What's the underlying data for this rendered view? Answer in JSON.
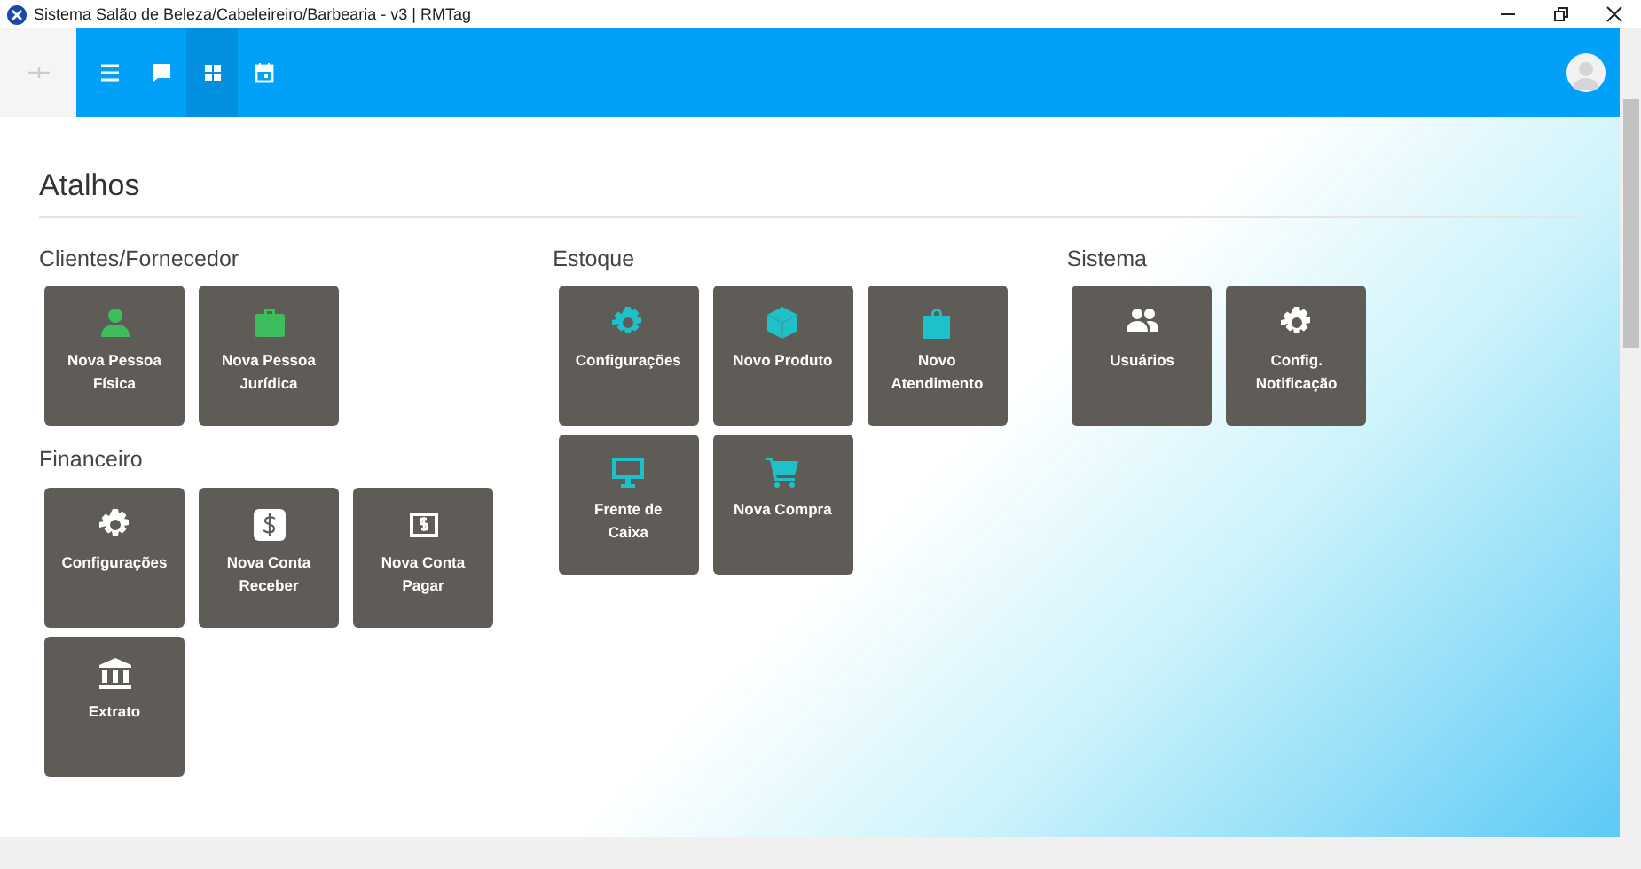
{
  "window": {
    "title": "Sistema Salão de Beleza/Cabeleireiro/Barbearia - v3 | RMTag"
  },
  "toolbar": {
    "items": [
      {
        "kind": "menu",
        "selected": false
      },
      {
        "kind": "chat",
        "selected": false
      },
      {
        "kind": "grid",
        "selected": true
      },
      {
        "kind": "calendar",
        "selected": false
      }
    ]
  },
  "page_title": "Atalhos",
  "columns": [
    {
      "groups": [
        {
          "title": "Clientes/Fornecedor",
          "color": "#3dbd5d",
          "tiles": [
            {
              "kind": "person",
              "label": "Nova Pessoa Física"
            },
            {
              "kind": "briefcase",
              "label": "Nova Pessoa Jurídica"
            }
          ]
        },
        {
          "title": "Financeiro",
          "color": "#ffffff",
          "tiles": [
            {
              "kind": "gear",
              "label": "Configurações"
            },
            {
              "kind": "dollar",
              "label": "Nova Conta Receber"
            },
            {
              "kind": "bill",
              "label": "Nova Conta Pagar"
            },
            {
              "kind": "bank",
              "label": "Extrato"
            }
          ]
        }
      ]
    },
    {
      "groups": [
        {
          "title": "Estoque",
          "color": "#1fc1c9",
          "tiles": [
            {
              "kind": "gear",
              "label": "Configurações"
            },
            {
              "kind": "box",
              "label": "Novo Produto"
            },
            {
              "kind": "bag",
              "label": "Novo Atendimento"
            },
            {
              "kind": "monitor",
              "label": "Frente de Caixa"
            },
            {
              "kind": "cart",
              "label": "Nova Compra"
            }
          ]
        }
      ]
    },
    {
      "groups": [
        {
          "title": "Sistema",
          "color": "#ffffff",
          "tiles": [
            {
              "kind": "users",
              "label": "Usuários"
            },
            {
              "kind": "gear",
              "label": "Config. Notificação"
            }
          ]
        }
      ]
    }
  ]
}
